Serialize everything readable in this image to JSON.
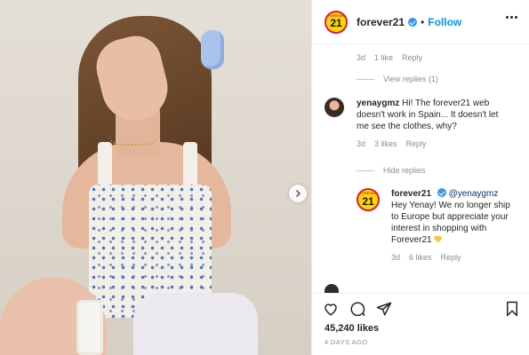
{
  "post": {
    "username": "forever21",
    "follow_label": "Follow",
    "logo_top": "FOREVER",
    "logo_number": "21"
  },
  "comments": {
    "first_meta": {
      "time": "3d",
      "likes": "1 like",
      "reply": "Reply"
    },
    "view_replies": "View replies (1)",
    "comment2": {
      "username": "yenaygmz",
      "text": "Hi! The forever21 web doesn't work in Spain... It doesn't let me see the clothes, why?",
      "time": "3d",
      "likes": "3 likes",
      "reply": "Reply"
    },
    "hide_replies": "Hide replies",
    "reply1": {
      "username": "forever21",
      "mention": "@yenaygmz",
      "text": "Hey Yenay! We no longer ship to Europe but appreciate your interest in shopping with Forever21",
      "time": "3d",
      "likes": "6 likes",
      "reply": "Reply"
    }
  },
  "footer": {
    "likes": "45,240 likes",
    "date": "4 DAYS AGO"
  },
  "icons": [
    "heart-icon",
    "comment-icon",
    "share-icon",
    "bookmark-icon",
    "more-icon",
    "chevron-right-icon",
    "verified-icon"
  ],
  "colors": {
    "follow": "#0095f6",
    "verified": "#3897f0",
    "logo_bg": "#ffd600",
    "logo_ring": "#d6203a"
  }
}
